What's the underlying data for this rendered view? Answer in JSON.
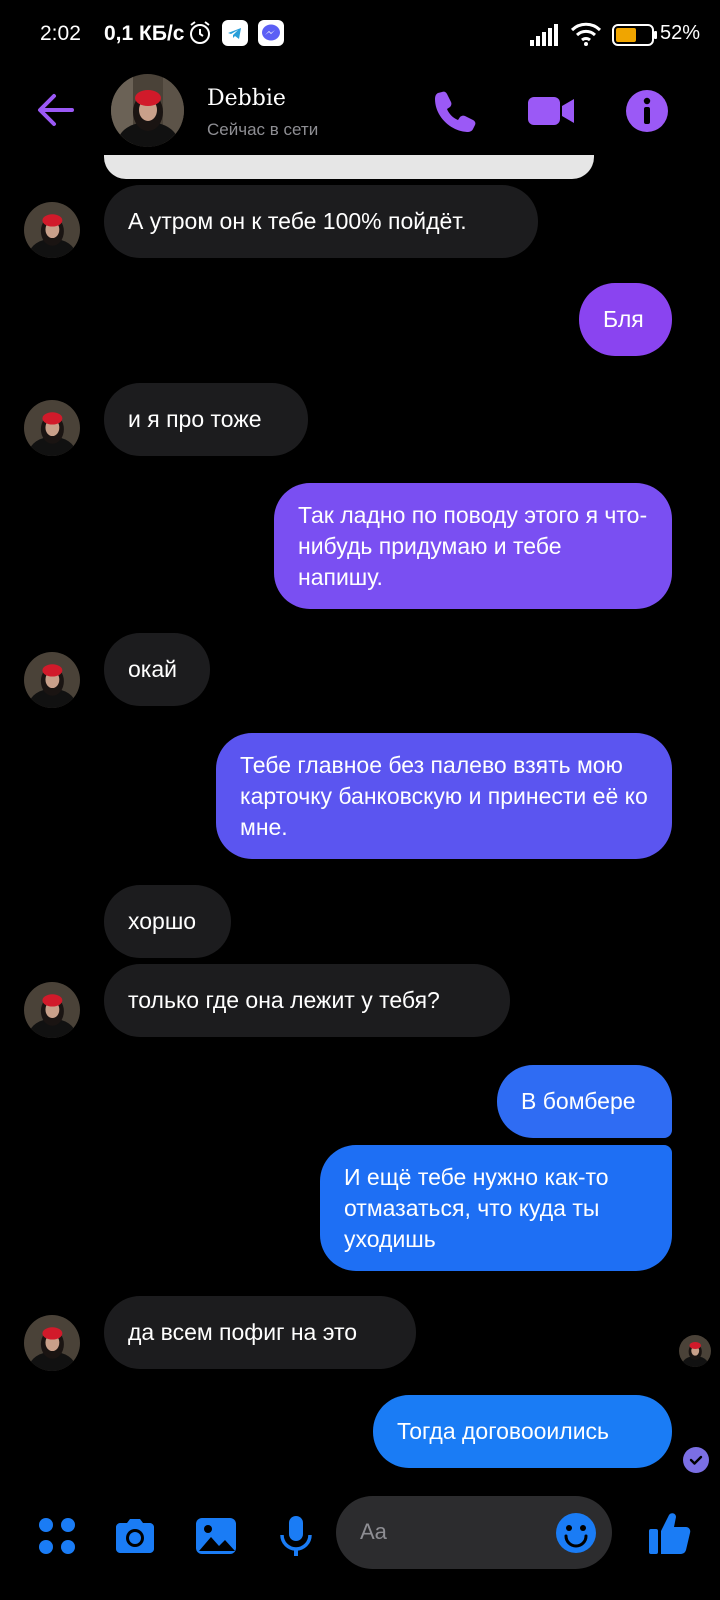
{
  "status_bar": {
    "time": "2:02",
    "speed": "0,1 КБ/с",
    "battery_pct": "52%",
    "icons": [
      "alarm-icon",
      "telegram-icon",
      "messenger-icon",
      "signal-icon",
      "wifi-icon",
      "battery-icon"
    ]
  },
  "header": {
    "contact_name": "Debbie",
    "status": "Сейчас в сети",
    "accent_color": "#9b59f6"
  },
  "messages": [
    {
      "from": "them",
      "text": "А утром он к тебе 100% пойдёт."
    },
    {
      "from": "me",
      "text": "Бля"
    },
    {
      "from": "them",
      "text": "и я про тоже"
    },
    {
      "from": "me",
      "text": "Так ладно по поводу этого я что-нибудь придумаю и тебе напишу."
    },
    {
      "from": "them",
      "text": "окай"
    },
    {
      "from": "me",
      "text": "Тебе главное без палево взять мою карточку банковскую и принести её ко мне."
    },
    {
      "from": "them",
      "text": "хоршо"
    },
    {
      "from": "them",
      "text": "только где она лежит у тебя?"
    },
    {
      "from": "me",
      "text": "В бомбере"
    },
    {
      "from": "me",
      "text": "И ещё тебе нужно как-то отмазаться, что куда ты уходишь"
    },
    {
      "from": "them",
      "text": "да всем пофиг на это"
    },
    {
      "from": "me",
      "text": "Тогда договооились"
    }
  ],
  "composer": {
    "placeholder": "Aa",
    "accent_color": "#1a7cf5"
  }
}
